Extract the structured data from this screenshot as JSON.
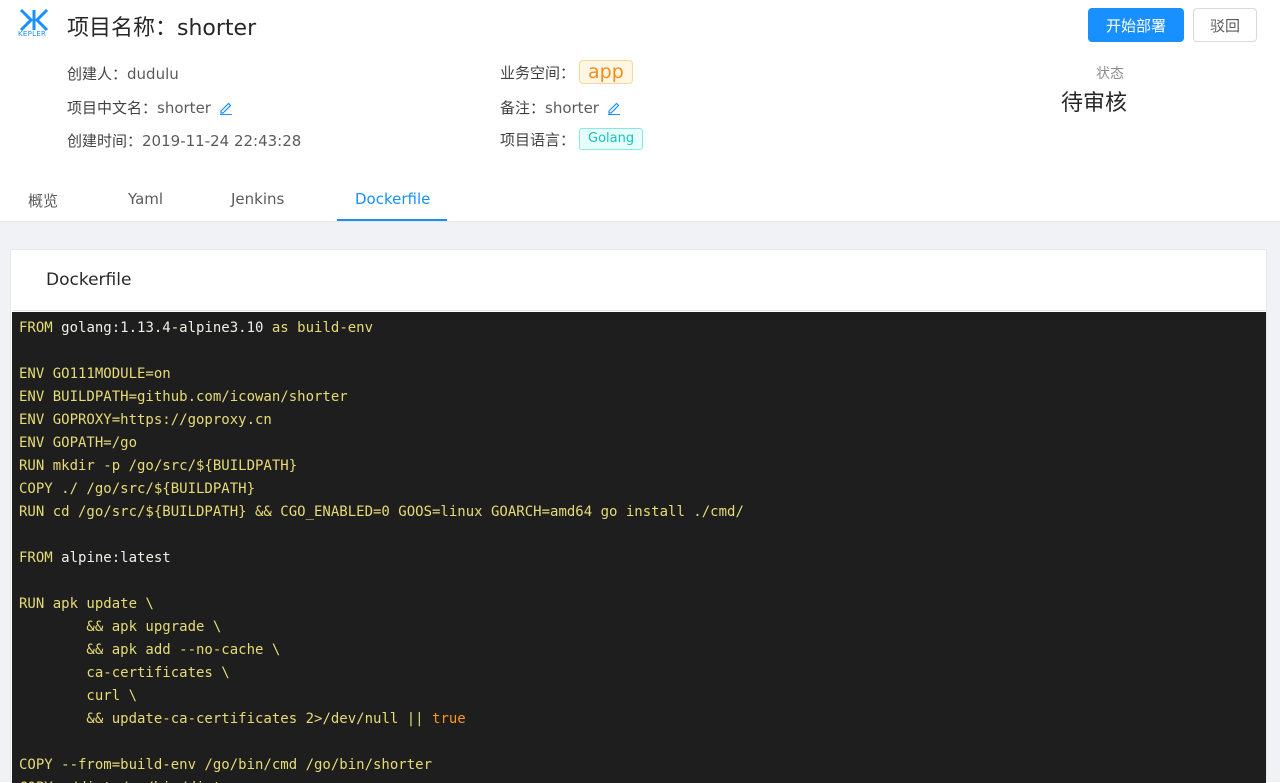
{
  "header": {
    "logo_text": "KEPLER",
    "title": "项目名称：shorter",
    "deploy_button": "开始部署",
    "reject_button": "驳回"
  },
  "info": {
    "creator_label": "创建人：",
    "creator": "dudulu",
    "cn_name_label": "项目中文名：",
    "cn_name": "shorter",
    "created_label": "创建时间：",
    "created": "2019-11-24 22:43:28",
    "namespace_label": "业务空间：",
    "namespace": "app",
    "remark_label": "备注：",
    "remark": "shorter",
    "language_label": "项目语言：",
    "language": "Golang",
    "status_label": "状态",
    "status": "待审核"
  },
  "tabs": [
    "概览",
    "Yaml",
    "Jenkins",
    "Dockerfile"
  ],
  "active_tab": "Dockerfile",
  "card": {
    "title": "Dockerfile"
  },
  "code_lines": [
    "FROM golang:1.13.4-alpine3.10 as build-env",
    "",
    "ENV GO111MODULE=on",
    "ENV BUILDPATH=github.com/icowan/shorter",
    "ENV GOPROXY=https://goproxy.cn",
    "ENV GOPATH=/go",
    "RUN mkdir -p /go/src/${BUILDPATH}",
    "COPY ./ /go/src/${BUILDPATH}",
    "RUN cd /go/src/${BUILDPATH} && CGO_ENABLED=0 GOOS=linux GOARCH=amd64 go install ./cmd/",
    "",
    "FROM alpine:latest",
    "",
    "RUN apk update \\",
    "        && apk upgrade \\",
    "        && apk add --no-cache \\",
    "        ca-certificates \\",
    "        curl \\",
    "        && update-ca-certificates 2>/dev/null || true",
    "",
    "COPY --from=build-env /go/bin/cmd /go/bin/shorter",
    "COPY ./dist /go/bin/dist"
  ],
  "colors": {
    "primary": "#1890ff",
    "code_bg": "#1e1e1e",
    "code_text": "#e6db74",
    "tag_app": "#fa8c16",
    "tag_lang": "#13c2c2"
  },
  "icons": {
    "logo": "kepler-logo",
    "edit": "edit-pencil-icon"
  }
}
